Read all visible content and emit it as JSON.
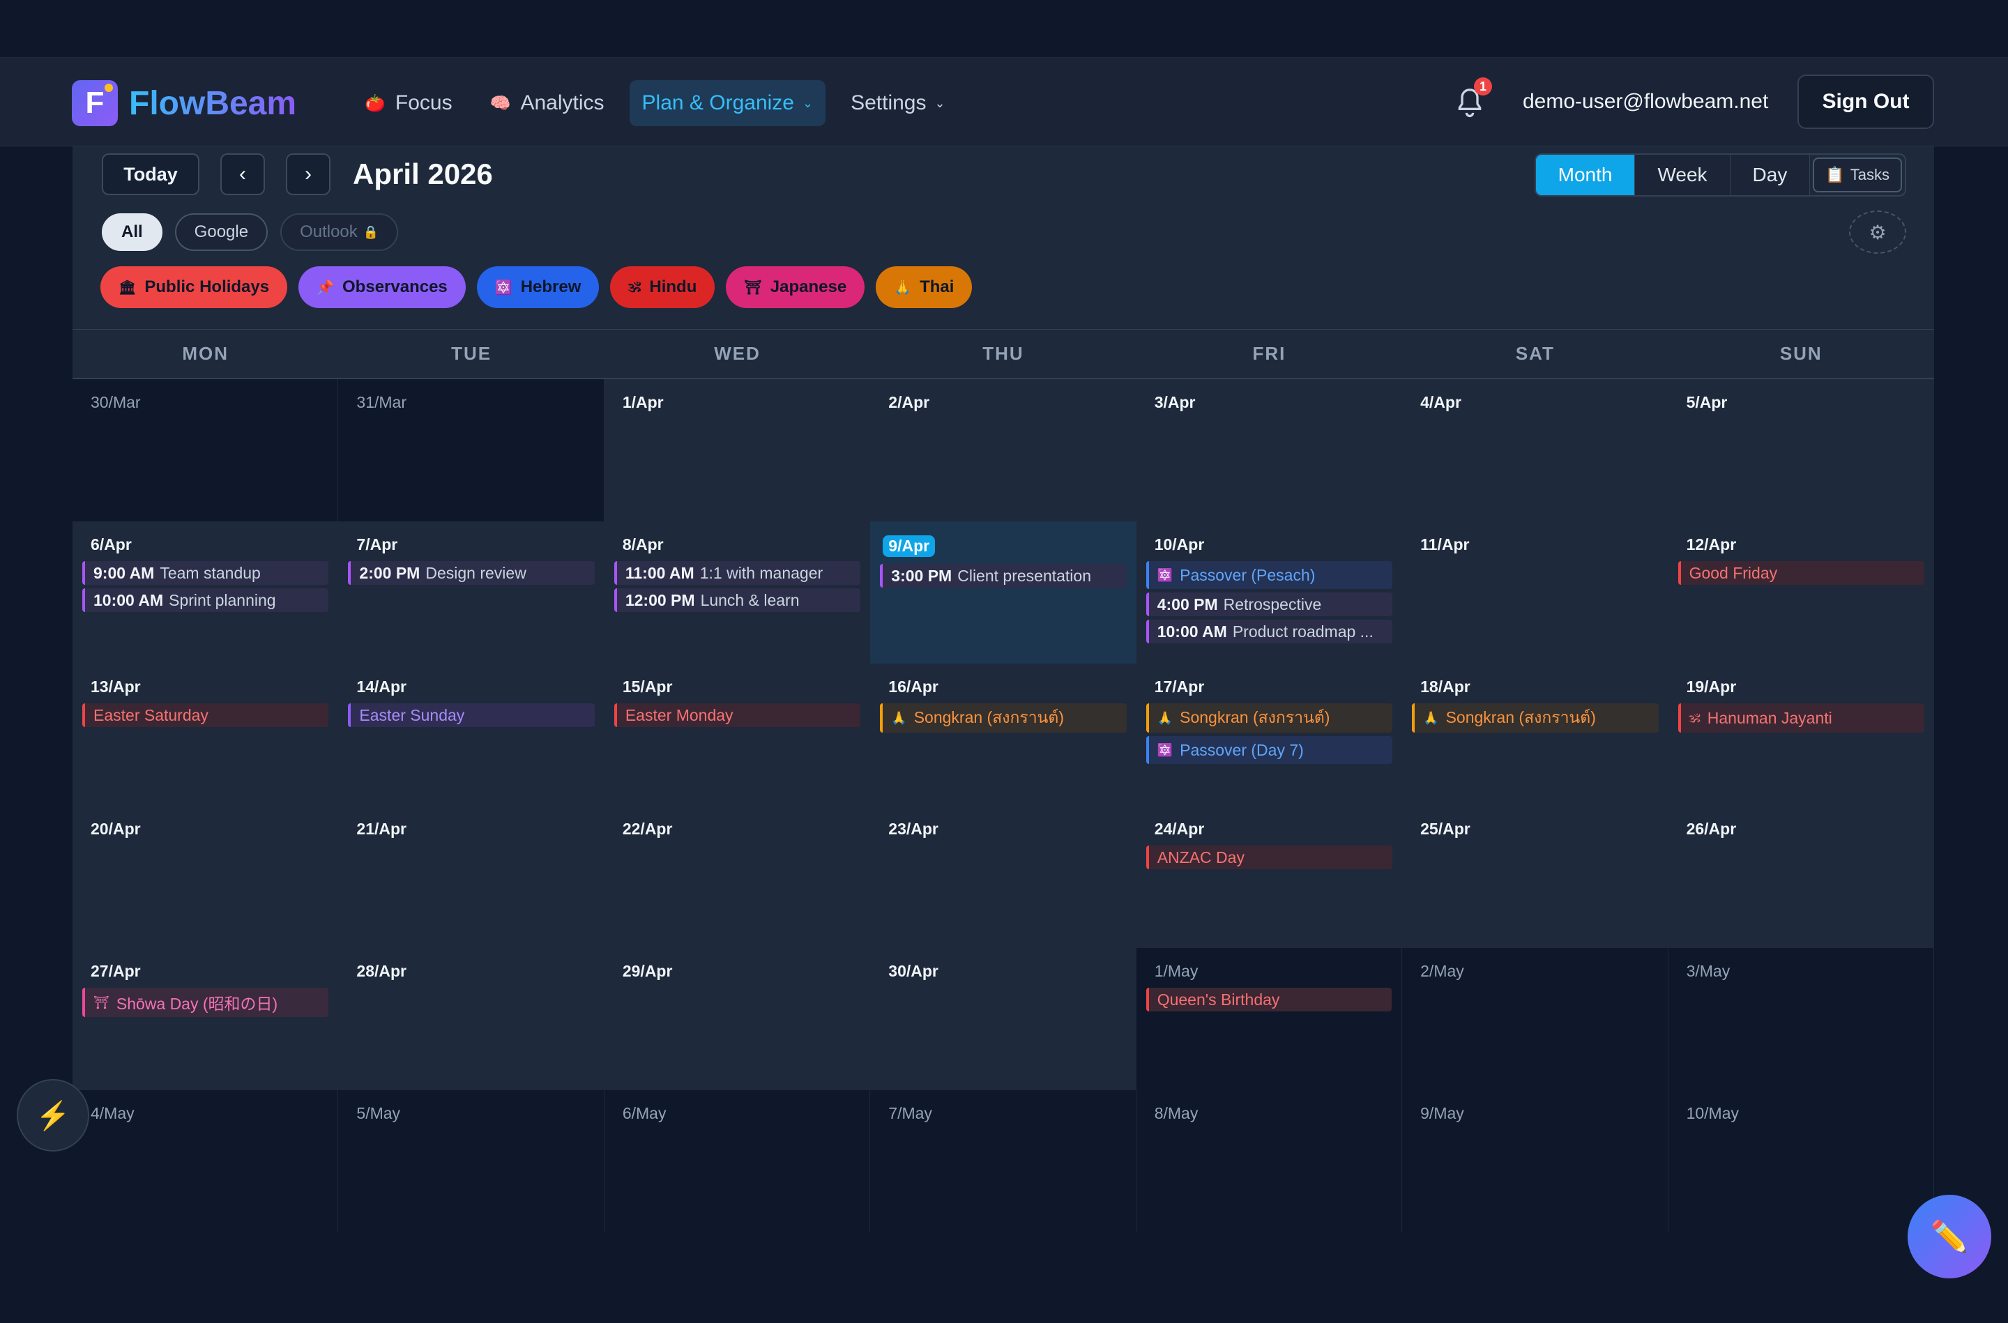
{
  "app": {
    "name": "FlowBeam",
    "logo_letter": "F"
  },
  "nav": {
    "items": [
      {
        "label": "Focus",
        "emoji": "🍅",
        "icon": "tomato-icon"
      },
      {
        "label": "Analytics",
        "emoji": "🧠",
        "icon": "brain-icon"
      },
      {
        "label": "Plan & Organize",
        "caret": "⌄",
        "active": true
      },
      {
        "label": "Settings",
        "caret": "⌄"
      }
    ]
  },
  "header": {
    "notification_count": "1",
    "user_email": "demo-user@flowbeam.net",
    "sign_out": "Sign Out"
  },
  "toolbar": {
    "today": "Today",
    "prev": "‹",
    "next": "›",
    "month_title": "April 2026",
    "views": [
      "Month",
      "Week",
      "Day"
    ],
    "active_view": "Month",
    "tasks": "Tasks",
    "tasks_emoji": "📋"
  },
  "sources": {
    "all": "All",
    "google": "Google",
    "outlook": "Outlook",
    "outlook_lock": "🔒"
  },
  "filters": [
    {
      "label": "Public Holidays",
      "emoji": "🏛",
      "color": "#ef4444"
    },
    {
      "label": "Observances",
      "emoji": "📌",
      "color": "#8b5cf6"
    },
    {
      "label": "Hebrew",
      "emoji": "🔯",
      "color": "#2563eb"
    },
    {
      "label": "Hindu",
      "emoji": "🕉",
      "color": "#dc2626"
    },
    {
      "label": "Japanese",
      "emoji": "⛩",
      "color": "#db2777"
    },
    {
      "label": "Thai",
      "emoji": "🙏",
      "color": "#d97706"
    }
  ],
  "weekdays": [
    "MON",
    "TUE",
    "WED",
    "THU",
    "FRI",
    "SAT",
    "SUN"
  ],
  "weeks": [
    [
      {
        "date": "30/Mar",
        "muted": true
      },
      {
        "date": "31/Mar",
        "muted": true
      },
      {
        "date": "1/Apr"
      },
      {
        "date": "2/Apr"
      },
      {
        "date": "3/Apr"
      },
      {
        "date": "4/Apr"
      },
      {
        "date": "5/Apr"
      }
    ],
    [
      {
        "date": "6/Apr",
        "events": [
          {
            "time": "9:00 AM",
            "title": "Team standup"
          },
          {
            "time": "10:00 AM",
            "title": "Sprint planning"
          }
        ]
      },
      {
        "date": "7/Apr",
        "events": [
          {
            "time": "2:00 PM",
            "title": "Design review"
          }
        ]
      },
      {
        "date": "8/Apr",
        "events": [
          {
            "time": "11:00 AM",
            "title": "1:1 with manager"
          },
          {
            "time": "12:00 PM",
            "title": "Lunch & learn"
          }
        ]
      },
      {
        "date": "9/Apr",
        "today": true,
        "events": [
          {
            "time": "3:00 PM",
            "title": "Client presentation"
          }
        ]
      },
      {
        "date": "10/Apr",
        "events": [
          {
            "kind": "hebrew",
            "icon": "🔯",
            "title": "Passover (Pesach)"
          },
          {
            "time": "4:00 PM",
            "title": "Retrospective"
          },
          {
            "time": "10:00 AM",
            "title": "Product roadmap ..."
          }
        ]
      },
      {
        "date": "11/Apr"
      },
      {
        "date": "12/Apr",
        "events": [
          {
            "kind": "holiday",
            "title": "Good Friday"
          }
        ]
      }
    ],
    [
      {
        "date": "13/Apr",
        "events": [
          {
            "kind": "holiday",
            "title": "Easter Saturday"
          }
        ]
      },
      {
        "date": "14/Apr",
        "events": [
          {
            "kind": "observ",
            "title": "Easter Sunday"
          }
        ]
      },
      {
        "date": "15/Apr",
        "events": [
          {
            "kind": "holiday",
            "title": "Easter Monday"
          }
        ]
      },
      {
        "date": "16/Apr",
        "events": [
          {
            "kind": "thai",
            "icon": "🙏",
            "title": "Songkran (สงกรานต์)"
          }
        ]
      },
      {
        "date": "17/Apr",
        "events": [
          {
            "kind": "thai",
            "icon": "🙏",
            "title": "Songkran (สงกรานต์)"
          },
          {
            "kind": "hebrew",
            "icon": "🔯",
            "title": "Passover (Day 7)"
          }
        ]
      },
      {
        "date": "18/Apr",
        "events": [
          {
            "kind": "thai",
            "icon": "🙏",
            "title": "Songkran (สงกรานต์)"
          }
        ]
      },
      {
        "date": "19/Apr",
        "events": [
          {
            "kind": "hindu",
            "icon": "🕉",
            "title": "Hanuman Jayanti"
          }
        ]
      }
    ],
    [
      {
        "date": "20/Apr"
      },
      {
        "date": "21/Apr"
      },
      {
        "date": "22/Apr"
      },
      {
        "date": "23/Apr"
      },
      {
        "date": "24/Apr",
        "events": [
          {
            "kind": "holiday",
            "title": "ANZAC Day"
          }
        ]
      },
      {
        "date": "25/Apr"
      },
      {
        "date": "26/Apr"
      }
    ],
    [
      {
        "date": "27/Apr",
        "events": [
          {
            "kind": "japanese",
            "icon": "⛩",
            "title": "Shōwa Day (昭和の日)"
          }
        ]
      },
      {
        "date": "28/Apr"
      },
      {
        "date": "29/Apr"
      },
      {
        "date": "30/Apr"
      },
      {
        "date": "1/May",
        "muted": true,
        "events": [
          {
            "kind": "holiday",
            "title": "Queen's Birthday"
          }
        ]
      },
      {
        "date": "2/May",
        "muted": true
      },
      {
        "date": "3/May",
        "muted": true
      }
    ],
    [
      {
        "date": "4/May",
        "muted": true
      },
      {
        "date": "5/May",
        "muted": true
      },
      {
        "date": "6/May",
        "muted": true
      },
      {
        "date": "7/May",
        "muted": true
      },
      {
        "date": "8/May",
        "muted": true
      },
      {
        "date": "9/May",
        "muted": true
      },
      {
        "date": "10/May",
        "muted": true
      }
    ]
  ],
  "fab": {
    "left_icon": "⚡",
    "right_icon": "✏️"
  },
  "colors": {
    "accent": "#0ea5e9",
    "background": "#0f172a",
    "panel": "#1e293b"
  }
}
